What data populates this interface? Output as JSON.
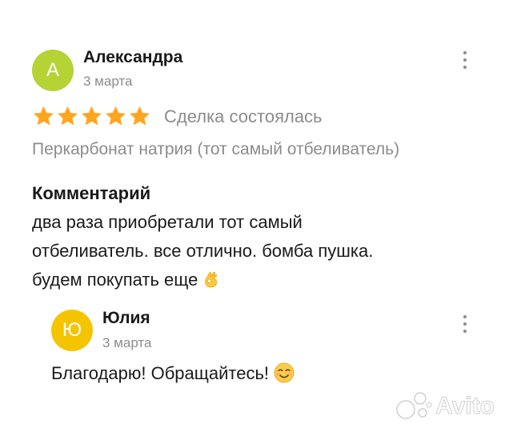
{
  "review": {
    "avatar_letter": "А",
    "avatar_color": "#b5d334",
    "author_name": "Александра",
    "date": "3 марта",
    "rating": 5,
    "max_rating": 5,
    "star_color": "#ffa51e",
    "deal_status": "Сделка состоялась",
    "item_title": "Перкарбонат натрия (тот самый отбеливатель)",
    "comment_heading": "Комментарий",
    "comment_line_1": "два раза приобретали тот самый",
    "comment_line_2": "отбеливатель. все отлично. бомба пушка.",
    "comment_line_3": "будем покупать еще",
    "comment_emoji": "ok-hand-emoji"
  },
  "reply": {
    "avatar_letter": "Ю",
    "avatar_color": "#f5c400",
    "author_name": "Юлия",
    "date": "3 марта",
    "text": "Благодарю! Обращайтесь!",
    "emoji": "smiling-face-emoji"
  },
  "watermark": {
    "brand": "Avito"
  },
  "icons": {
    "more": "more-vertical-icon",
    "star": "star-icon"
  }
}
